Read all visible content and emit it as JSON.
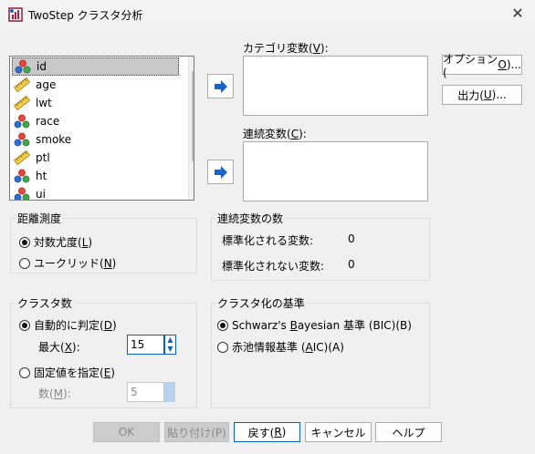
{
  "window": {
    "title": "TwoStep クラスタ分析",
    "close_glyph": "✕"
  },
  "variables": [
    {
      "name": "id",
      "type": "nominal"
    },
    {
      "name": "age",
      "type": "scale"
    },
    {
      "name": "lwt",
      "type": "scale"
    },
    {
      "name": "race",
      "type": "nominal"
    },
    {
      "name": "smoke",
      "type": "nominal"
    },
    {
      "name": "ptl",
      "type": "scale"
    },
    {
      "name": "ht",
      "type": "nominal"
    },
    {
      "name": "ui",
      "type": "nominal"
    }
  ],
  "categorical": {
    "label_prefix": "カテゴリ変数(",
    "mnemonic": "V",
    "label_suffix": "):"
  },
  "continuous": {
    "label_prefix": "連続変数(",
    "mnemonic": "C",
    "label_suffix": "):"
  },
  "buttons": {
    "options": {
      "prefix": "オプション(",
      "mnemonic": "O",
      "suffix": ")..."
    },
    "output": {
      "prefix": "出力(",
      "mnemonic": "U",
      "suffix": ")..."
    },
    "ok": "OK",
    "paste": "貼り付け(P)",
    "reset": {
      "prefix": "戻す(",
      "mnemonic": "R",
      "suffix": ")"
    },
    "cancel": "キャンセル",
    "help": "ヘルプ"
  },
  "distance": {
    "title": "距離測度",
    "loglik": {
      "prefix": "対数尤度(",
      "mnemonic": "L",
      "suffix": ")",
      "selected": true
    },
    "euclid": {
      "prefix": "ユークリッド(",
      "mnemonic": "N",
      "suffix": ")",
      "selected": false
    }
  },
  "count": {
    "title": "連続変数の数",
    "standardized_label": "標準化される変数:",
    "standardized_value": "0",
    "unstandardized_label": "標準化されない変数:",
    "unstandardized_value": "0"
  },
  "clusters": {
    "title": "クラスタ数",
    "auto": {
      "prefix": "自動的に判定(",
      "mnemonic": "D",
      "suffix": ")",
      "selected": true
    },
    "max": {
      "prefix": "最大(",
      "mnemonic": "X",
      "suffix": "):",
      "value": "15"
    },
    "fixed": {
      "prefix": "固定値を指定(",
      "mnemonic": "E",
      "suffix": ")",
      "selected": false
    },
    "num": {
      "prefix": "数(",
      "mnemonic": "M",
      "suffix": "):",
      "value": "5"
    }
  },
  "criterion": {
    "title": "クラスタ化の基準",
    "bic": {
      "prefix": "Schwarz's ",
      "mnemonic": "B",
      "suffix": "ayesian 基準 (BIC)(B)",
      "selected": true
    },
    "aic": {
      "prefix": "赤池情報基準 (",
      "mnemonic": "A",
      "suffix": "IC)(A)",
      "selected": false
    }
  },
  "colors": {
    "accent": "#0a5fc4",
    "arrow_blue": "#1a64c8",
    "selection": "#c8c8c8"
  }
}
